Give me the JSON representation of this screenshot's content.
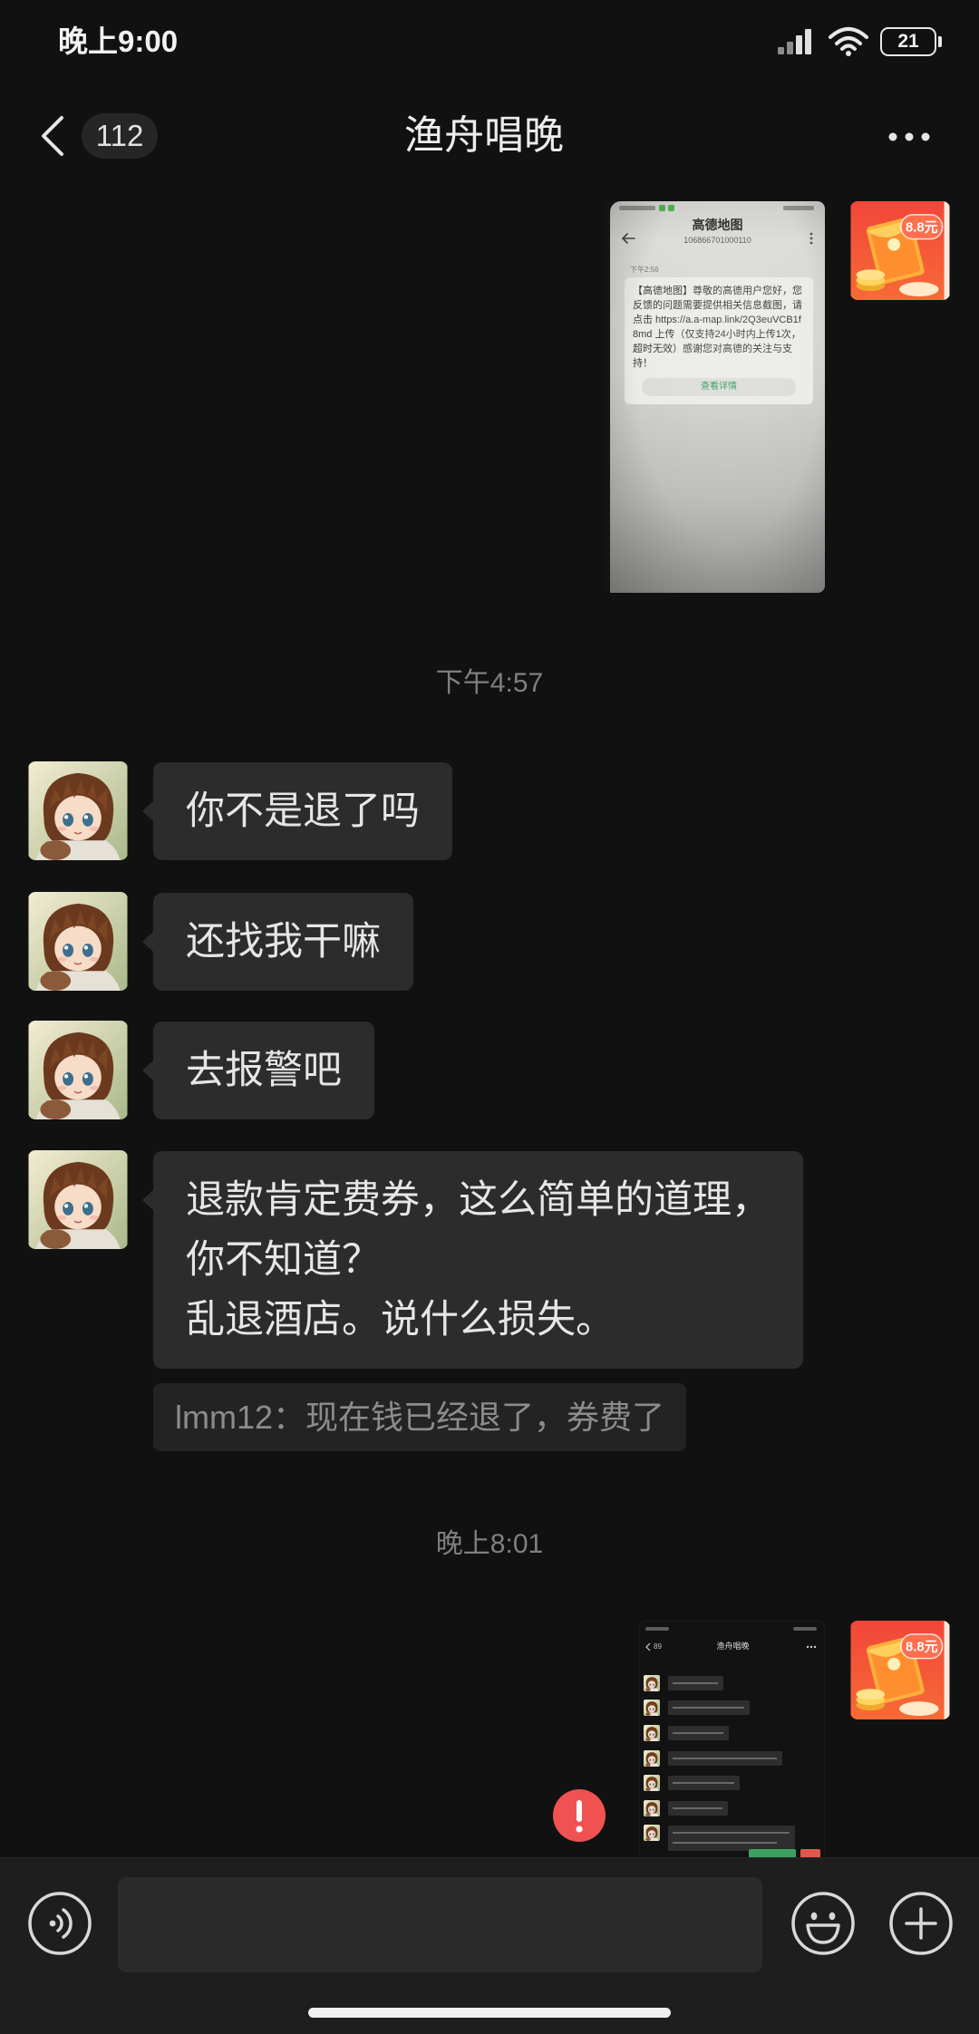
{
  "status_bar": {
    "time": "晚上9:00",
    "battery": "21",
    "icons": [
      "signal-icon",
      "wifi-icon",
      "battery-icon"
    ]
  },
  "header": {
    "back_icon": "chevron-left-icon",
    "unread_count": "112",
    "title": "渔舟唱晚",
    "more_icon": "more-icon"
  },
  "me": {
    "avatar": "red-packet-avatar",
    "avatar_text": "8.8元"
  },
  "contact": {
    "avatar": "anime-boy-avatar"
  },
  "out_image_1": {
    "sms_app_title": "高德地图",
    "sms_number": "106866701000110",
    "sms_time": "下午2:56",
    "sms_body": "【高德地图】尊敬的高德用户您好，您反馈的问题需要提供相关信息截图，请点击 https://a.a-map.link/2Q3euVCB1f8md 上传（仅支持24小时内上传1次，超时无效）感谢您对高德的关注与支持！",
    "sms_button": "查看详情"
  },
  "timestamps": [
    "下午4:57",
    "晚上8:01"
  ],
  "incoming": [
    {
      "lines": [
        "你不是退了吗"
      ]
    },
    {
      "lines": [
        "还找我干嘛"
      ]
    },
    {
      "lines": [
        "去报警吧"
      ]
    },
    {
      "lines": [
        "退款肯定费券，这么简单的道理，",
        "你不知道？",
        "乱退酒店。说什么损失。"
      ]
    }
  ],
  "quote": "lmm12：现在钱已经退了，券费了",
  "out_image_2": {
    "header_count": "89",
    "title": "渔舟唱晚",
    "failed_icon": "exclamation-icon"
  },
  "input_bar": {
    "voice_icon": "voice-icon",
    "input_value": "",
    "emoji_icon": "emoji-icon",
    "plus_icon": "plus-icon"
  },
  "colors": {
    "background": "#111111",
    "bubble": "#2c2c2c",
    "text": "#e6e6e6",
    "timestamp": "#7f7f7f",
    "error": "#f05252",
    "input_bar": "#1e1e1e"
  }
}
